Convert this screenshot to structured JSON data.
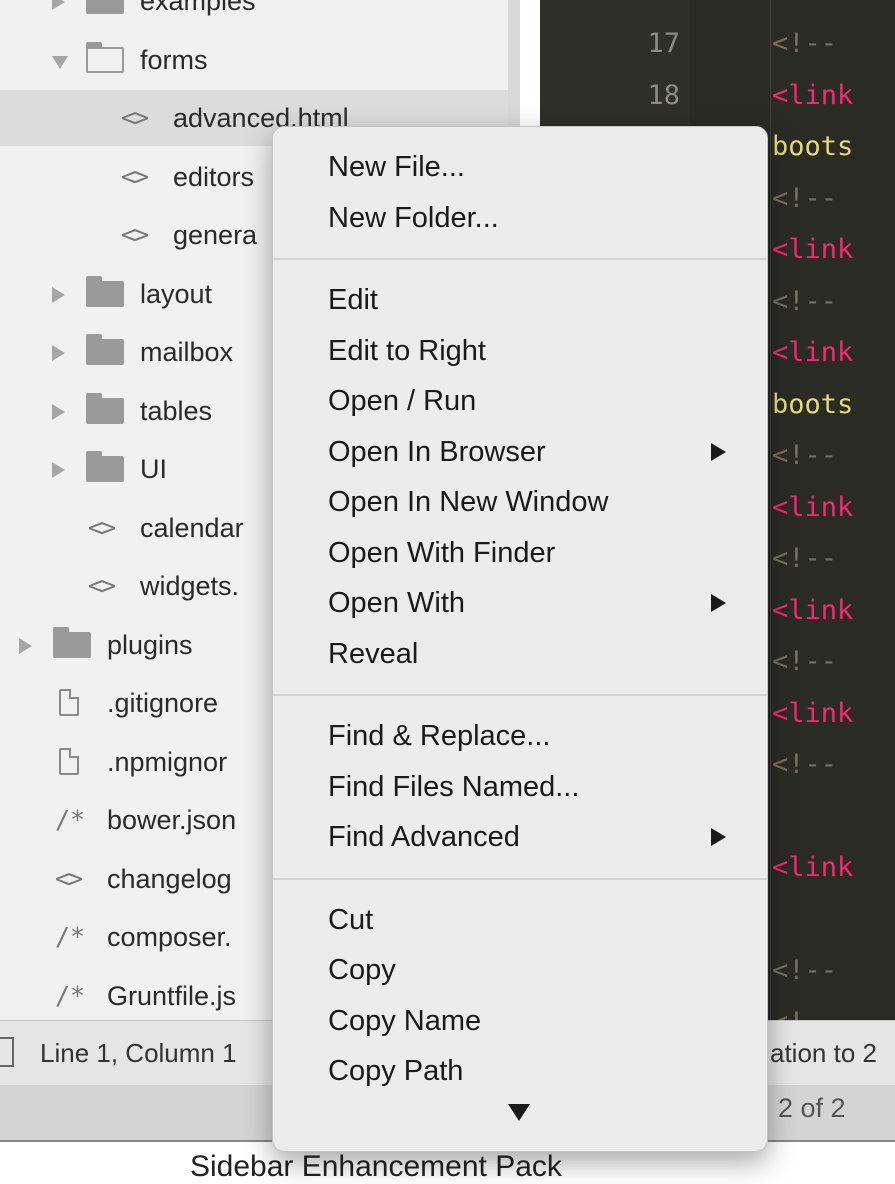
{
  "sidebar": {
    "rows": [
      {
        "label": "examples",
        "kind": "folder-closed",
        "indent": 0
      },
      {
        "label": "forms",
        "kind": "folder-open",
        "indent": 0
      },
      {
        "label": "advanced.html",
        "kind": "code-file",
        "indent": 1,
        "selected": true
      },
      {
        "label": "editors",
        "kind": "code-file",
        "indent": 1
      },
      {
        "label": "genera",
        "kind": "code-file",
        "indent": 1
      },
      {
        "label": "layout",
        "kind": "folder-closed",
        "indent": 0
      },
      {
        "label": "mailbox",
        "kind": "folder-closed",
        "indent": 0
      },
      {
        "label": "tables",
        "kind": "folder-closed",
        "indent": 0
      },
      {
        "label": "UI",
        "kind": "folder-closed",
        "indent": 0
      },
      {
        "label": "calendar",
        "kind": "code-file",
        "indent": 0
      },
      {
        "label": "widgets.",
        "kind": "code-file",
        "indent": 0
      },
      {
        "label": "plugins",
        "kind": "folder-closed",
        "indent": -1
      },
      {
        "label": ".gitignore",
        "kind": "plain-file",
        "indent": -1
      },
      {
        "label": ".npmignor",
        "kind": "plain-file",
        "indent": -1
      },
      {
        "label": "bower.json",
        "kind": "comment-file",
        "indent": -1
      },
      {
        "label": "changelog",
        "kind": "code-file",
        "indent": -1
      },
      {
        "label": "composer.",
        "kind": "comment-file",
        "indent": -1
      },
      {
        "label": "Gruntfile.js",
        "kind": "comment-file",
        "indent": -1
      }
    ]
  },
  "editor": {
    "lines": [
      {
        "num": "17",
        "parts": [
          {
            "t": "<!--",
            "c": "comment"
          }
        ]
      },
      {
        "num": "18",
        "parts": [
          {
            "t": "<link",
            "c": "tag"
          }
        ]
      },
      {
        "num": "",
        "parts": [
          {
            "t": "boots",
            "c": "string"
          }
        ]
      },
      {
        "num": "",
        "parts": [
          {
            "t": "<!--",
            "c": "comment"
          }
        ]
      },
      {
        "num": "",
        "parts": [
          {
            "t": "<link",
            "c": "tag"
          }
        ]
      },
      {
        "num": "",
        "parts": [
          {
            "t": "<!--",
            "c": "comment"
          }
        ]
      },
      {
        "num": "",
        "parts": [
          {
            "t": "<link",
            "c": "tag"
          }
        ]
      },
      {
        "num": "",
        "parts": [
          {
            "t": "boots",
            "c": "string"
          }
        ]
      },
      {
        "num": "",
        "parts": [
          {
            "t": "<!--",
            "c": "comment"
          }
        ]
      },
      {
        "num": "",
        "parts": [
          {
            "t": "<link",
            "c": "tag"
          }
        ]
      },
      {
        "num": "",
        "parts": [
          {
            "t": "<!--",
            "c": "comment"
          }
        ]
      },
      {
        "num": "",
        "parts": [
          {
            "t": "<link",
            "c": "tag"
          }
        ]
      },
      {
        "num": "",
        "parts": [
          {
            "t": "<!--",
            "c": "comment"
          }
        ]
      },
      {
        "num": "",
        "parts": [
          {
            "t": "<link",
            "c": "tag"
          }
        ]
      },
      {
        "num": "",
        "parts": [
          {
            "t": "<!--",
            "c": "comment"
          }
        ]
      },
      {
        "num": "",
        "parts": [
          {
            "t": "",
            "c": "plain"
          }
        ]
      },
      {
        "num": "",
        "parts": [
          {
            "t": "<link",
            "c": "tag"
          }
        ]
      },
      {
        "num": "",
        "parts": [
          {
            "t": "",
            "c": "plain"
          }
        ]
      },
      {
        "num": "",
        "parts": [
          {
            "t": "<!--",
            "c": "comment"
          }
        ]
      },
      {
        "num": "",
        "parts": [
          {
            "t": "<!--",
            "c": "comment"
          }
        ]
      },
      {
        "num": "",
        "parts": [
          {
            "t": "<!--[",
            "c": "comment"
          }
        ]
      }
    ]
  },
  "status": {
    "position": "Line 1, Column 1",
    "right": "ation to 2"
  },
  "find": {
    "count": "2 of 2"
  },
  "footer": {
    "caption": "Sidebar Enhancement Pack"
  },
  "context_menu": {
    "groups": [
      [
        {
          "label": "New File...",
          "submenu": false
        },
        {
          "label": "New Folder...",
          "submenu": false
        }
      ],
      [
        {
          "label": "Edit",
          "submenu": false
        },
        {
          "label": "Edit to Right",
          "submenu": false
        },
        {
          "label": "Open / Run",
          "submenu": false
        },
        {
          "label": "Open In Browser",
          "submenu": true
        },
        {
          "label": "Open In New Window",
          "submenu": false
        },
        {
          "label": "Open With Finder",
          "submenu": false
        },
        {
          "label": "Open With",
          "submenu": true
        },
        {
          "label": "Reveal",
          "submenu": false
        }
      ],
      [
        {
          "label": "Find & Replace...",
          "submenu": false
        },
        {
          "label": "Find Files Named...",
          "submenu": false
        },
        {
          "label": "Find Advanced",
          "submenu": true
        }
      ],
      [
        {
          "label": "Cut",
          "submenu": false
        },
        {
          "label": "Copy",
          "submenu": false
        },
        {
          "label": "Copy Name",
          "submenu": false
        },
        {
          "label": "Copy Path",
          "submenu": false
        }
      ]
    ],
    "more_indicator_icon": "chevron-down-icon"
  }
}
